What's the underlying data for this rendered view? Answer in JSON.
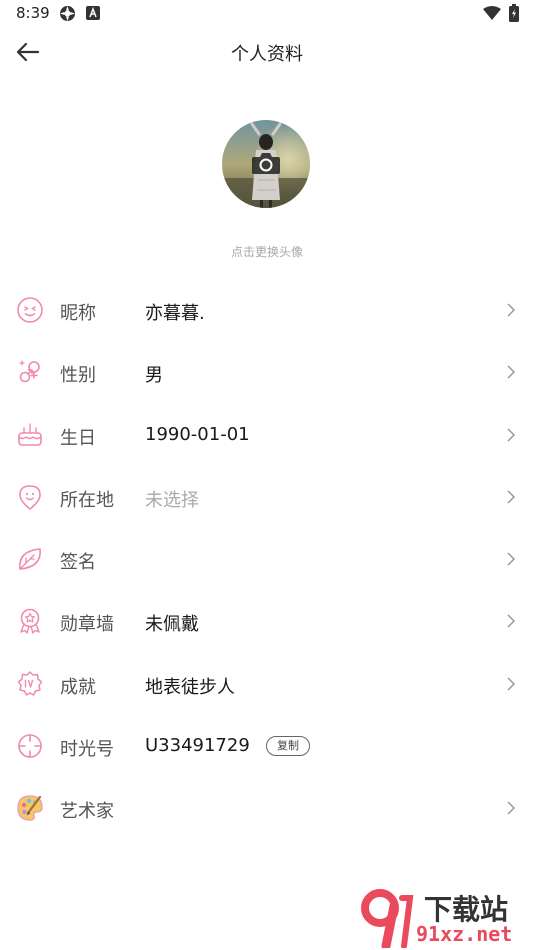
{
  "status": {
    "time": "8:39"
  },
  "header": {
    "title": "个人资料"
  },
  "avatar": {
    "hint": "点击更换头像"
  },
  "rows": [
    {
      "label": "昵称",
      "value": "亦暮暮.",
      "icon": "smile-face-icon"
    },
    {
      "label": "性别",
      "value": "男",
      "icon": "gender-icon"
    },
    {
      "label": "生日",
      "value": "1990-01-01",
      "icon": "cake-icon"
    },
    {
      "label": "所在地",
      "value": "未选择",
      "icon": "location-pin-icon"
    },
    {
      "label": "签名",
      "value": "",
      "icon": "leaf-icon"
    },
    {
      "label": "勋章墙",
      "value": "未佩戴",
      "icon": "medal-icon"
    },
    {
      "label": "成就",
      "value": "地表徒步人",
      "icon": "level-badge-icon"
    },
    {
      "label": "时光号",
      "value": "U33491729",
      "icon": "target-icon",
      "copy_label": "复制"
    },
    {
      "label": "艺术家",
      "value": "",
      "icon": "palette-icon"
    }
  ],
  "watermark": {
    "cn": "下载站",
    "url": "91xz.net"
  },
  "colors": {
    "accent_pink": "#f08aa8",
    "watermark_red": "#e94a5c"
  }
}
